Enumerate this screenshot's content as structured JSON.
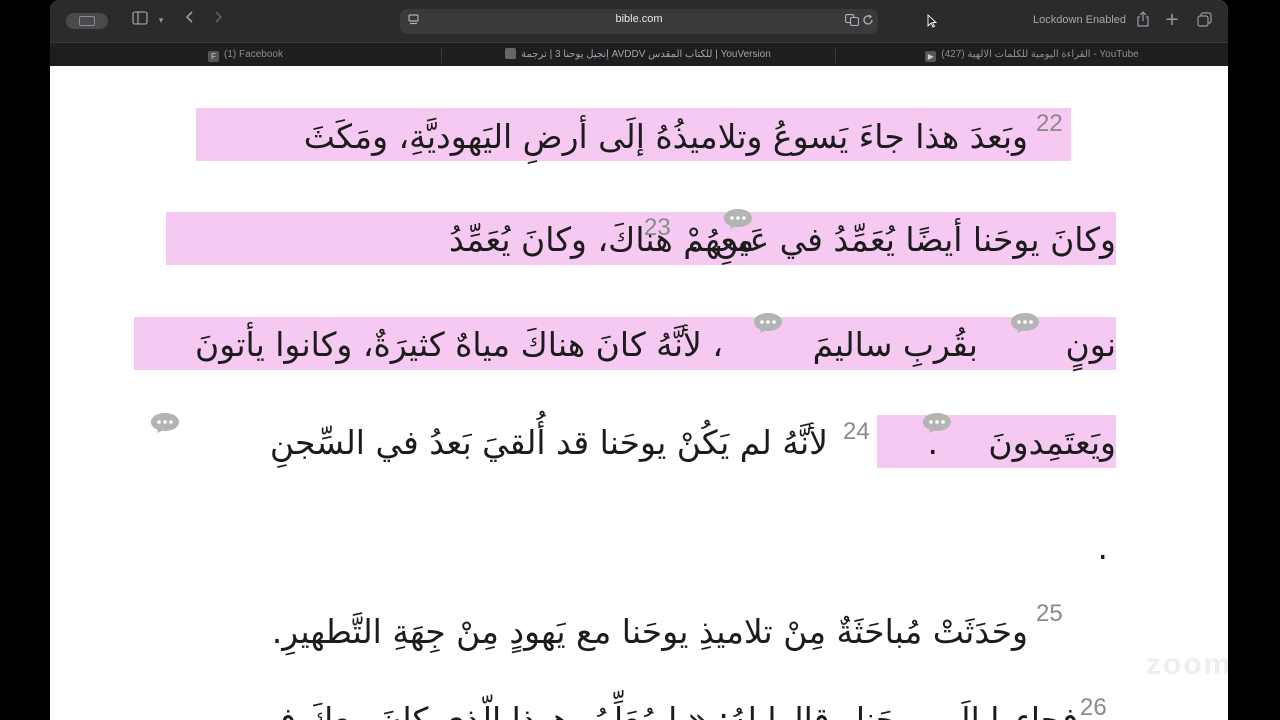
{
  "browser": {
    "url": "bible.com",
    "lockdown_label": "Lockdown Enabled",
    "tabs": [
      {
        "label": "(1) Facebook",
        "icon": "facebook-icon"
      },
      {
        "label": "إنجيل يوحنا 3 | ترجمة AVDDV للكتاب المقدس | YouVersion",
        "icon": "youversion-icon"
      },
      {
        "label": "(427) القراءة اليومية للكلمات الالهية - YouTube",
        "icon": "youtube-icon"
      }
    ]
  },
  "scripture": {
    "lines": [
      "وبَعدَ هذا جاءَ يَسوعُ وتلاميذُهُ إلَى أرضِ اليَهوديَّةِ، ومَكَثَ",
      "معهُمْ هناكَ، وكانَ يُعَمِّدُ",
      "وكانَ يوحَنا أيضًا يُعَمِّدُ في عَينِ",
      "نونٍ",
      "بقُربِ ساليمَ",
      "، لأنَّهُ كانَ هناكَ مياهٌ كثيرَةٌ، وكانوا يأتونَ",
      "ويَعتَمِدونَ",
      "لأنَّهُ لم يَكُنْ يوحَنا قد أُلقيَ بَعدُ في السِّجنِ",
      ".",
      "وحَدَثَتْ مُباحَثَةٌ مِنْ تلاميذِ يوحَنا مع يَهودٍ مِنْ جِهَةِ التَّطهيرِ.",
      "فجاءوا إلَى يوحَنا وقالوا لهُ: «يا مُعَلِّمُ، هوذا الّذي كانَ معكَ في"
    ],
    "verse_numbers": [
      "22",
      "23",
      "24",
      "25",
      "26"
    ],
    "period": "."
  },
  "colors": {
    "highlight": "#f6c9f2",
    "text": "#1c1c1c",
    "verse_number": "#8a8a8a"
  },
  "watermark": "zoom"
}
